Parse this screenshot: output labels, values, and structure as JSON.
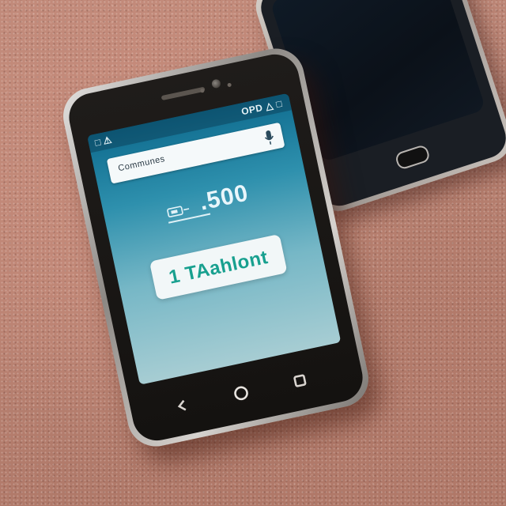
{
  "back_phone": {
    "screen_state": "off"
  },
  "front_phone": {
    "status_bar": {
      "left": "□ ⚠",
      "right": "OPD △ □"
    },
    "search_field": {
      "value": "Communes",
      "icon": "mic-icon"
    },
    "amount": {
      "icon": "sim-card-icon",
      "value": ".500"
    },
    "label": {
      "text": "1 TAahlont"
    },
    "nav_buttons": [
      "back-icon",
      "home-icon",
      "recent-apps-icon"
    ]
  },
  "colors": {
    "carpet": "#b98272",
    "screen_top": "#0f6c8f",
    "screen_bottom": "#a7cdd3",
    "label_text": "#18a08f"
  }
}
